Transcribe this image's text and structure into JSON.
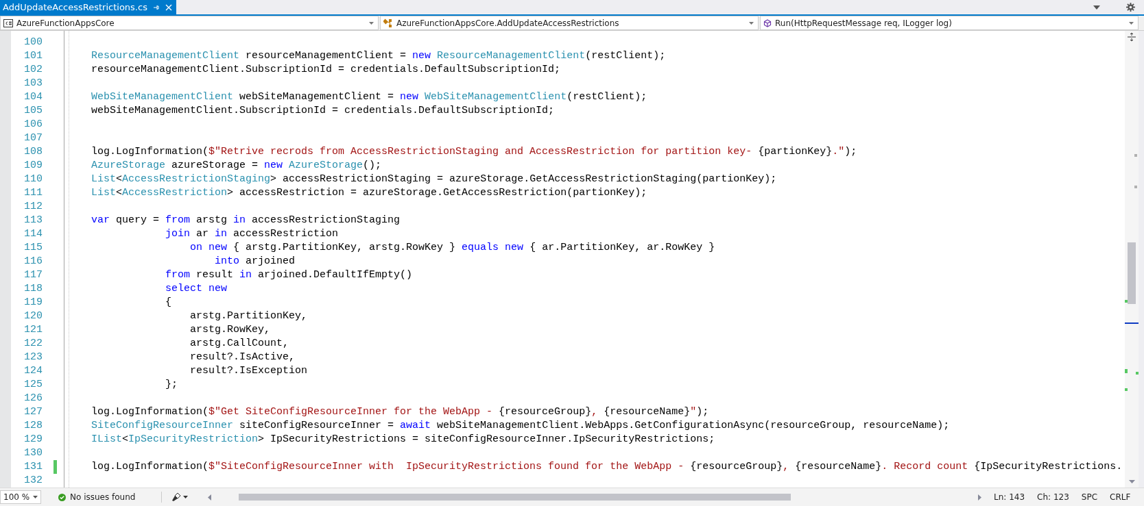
{
  "tab": {
    "title": "AddUpdateAccessRestrictions.cs",
    "selected": true
  },
  "nav": {
    "project": "AzureFunctionAppsCore",
    "type": "AzureFunctionAppsCore.AddUpdateAccessRestrictions",
    "member": "Run(HttpRequestMessage req, ILogger log)"
  },
  "editor": {
    "lines": [
      {
        "number": "100",
        "changed": false
      },
      {
        "number": "101",
        "changed": false,
        "tokens": [
          {
            "kind": "type",
            "text": "ResourceManagementClient"
          },
          {
            "kind": "plain",
            "text": " resourceManagementClient = "
          },
          {
            "kind": "keyword",
            "text": "new "
          },
          {
            "kind": "type",
            "text": "ResourceManagementClient"
          },
          {
            "kind": "plain",
            "text": "(restClient);"
          }
        ]
      },
      {
        "number": "102",
        "changed": false,
        "tokens": [
          {
            "kind": "plain",
            "text": "resourceManagementClient.SubscriptionId = credentials.DefaultSubscriptionId;"
          }
        ]
      },
      {
        "number": "103",
        "changed": false
      },
      {
        "number": "104",
        "changed": false,
        "tokens": [
          {
            "kind": "type",
            "text": "WebSiteManagementClient"
          },
          {
            "kind": "plain",
            "text": " webSiteManagementClient = "
          },
          {
            "kind": "keyword",
            "text": "new "
          },
          {
            "kind": "type",
            "text": "WebSiteManagementClient"
          },
          {
            "kind": "plain",
            "text": "(restClient);"
          }
        ]
      },
      {
        "number": "105",
        "changed": false,
        "tokens": [
          {
            "kind": "plain",
            "text": "webSiteManagementClient.SubscriptionId = credentials.DefaultSubscriptionId;"
          }
        ]
      },
      {
        "number": "106",
        "changed": false
      },
      {
        "number": "107",
        "changed": false
      },
      {
        "number": "108",
        "changed": false,
        "tokens": [
          {
            "kind": "plain",
            "text": "log.LogInformation("
          },
          {
            "kind": "string",
            "text": "$\"Retrive recrods from AccessRestrictionStaging and AccessRestriction for partition key- "
          },
          {
            "kind": "plain",
            "text": "{partionKey}"
          },
          {
            "kind": "string",
            "text": ".\""
          },
          {
            "kind": "plain",
            "text": ");"
          }
        ]
      },
      {
        "number": "109",
        "changed": false,
        "tokens": [
          {
            "kind": "type",
            "text": "AzureStorage"
          },
          {
            "kind": "plain",
            "text": " azureStorage = "
          },
          {
            "kind": "keyword",
            "text": "new "
          },
          {
            "kind": "type",
            "text": "AzureStorage"
          },
          {
            "kind": "plain",
            "text": "();"
          }
        ]
      },
      {
        "number": "110",
        "changed": false,
        "tokens": [
          {
            "kind": "type",
            "text": "List"
          },
          {
            "kind": "plain",
            "text": "<"
          },
          {
            "kind": "type",
            "text": "AccessRestrictionStaging"
          },
          {
            "kind": "plain",
            "text": "> accessRestrictionStaging = azureStorage.GetAccessRestrictionStaging(partionKey);"
          }
        ]
      },
      {
        "number": "111",
        "changed": false,
        "tokens": [
          {
            "kind": "type",
            "text": "List"
          },
          {
            "kind": "plain",
            "text": "<"
          },
          {
            "kind": "type",
            "text": "AccessRestriction"
          },
          {
            "kind": "plain",
            "text": "> accessRestriction = azureStorage.GetAccessRestriction(partionKey);"
          }
        ]
      },
      {
        "number": "112",
        "changed": false
      },
      {
        "number": "113",
        "changed": false,
        "tokens": [
          {
            "kind": "keyword",
            "text": "var"
          },
          {
            "kind": "plain",
            "text": " query = "
          },
          {
            "kind": "keyword",
            "text": "from"
          },
          {
            "kind": "plain",
            "text": " arstg "
          },
          {
            "kind": "keyword",
            "text": "in"
          },
          {
            "kind": "plain",
            "text": " accessRestrictionStaging"
          }
        ]
      },
      {
        "number": "114",
        "changed": false,
        "tokens": [
          {
            "kind": "keyword",
            "text": "            join"
          },
          {
            "kind": "plain",
            "text": " ar "
          },
          {
            "kind": "keyword",
            "text": "in"
          },
          {
            "kind": "plain",
            "text": " accessRestriction"
          }
        ]
      },
      {
        "number": "115",
        "changed": false,
        "tokens": [
          {
            "kind": "keyword",
            "text": "                on new"
          },
          {
            "kind": "plain",
            "text": " { arstg.PartitionKey, arstg.RowKey } "
          },
          {
            "kind": "keyword",
            "text": "equals new"
          },
          {
            "kind": "plain",
            "text": " { ar.PartitionKey, ar.RowKey }"
          }
        ]
      },
      {
        "number": "116",
        "changed": false,
        "tokens": [
          {
            "kind": "keyword",
            "text": "                    into"
          },
          {
            "kind": "plain",
            "text": " arjoined"
          }
        ]
      },
      {
        "number": "117",
        "changed": false,
        "tokens": [
          {
            "kind": "keyword",
            "text": "            from"
          },
          {
            "kind": "plain",
            "text": " result "
          },
          {
            "kind": "keyword",
            "text": "in"
          },
          {
            "kind": "plain",
            "text": " arjoined.DefaultIfEmpty()"
          }
        ]
      },
      {
        "number": "118",
        "changed": false,
        "tokens": [
          {
            "kind": "keyword",
            "text": "            select new"
          }
        ]
      },
      {
        "number": "119",
        "changed": false,
        "tokens": [
          {
            "kind": "plain",
            "text": "            {"
          }
        ]
      },
      {
        "number": "120",
        "changed": false,
        "tokens": [
          {
            "kind": "plain",
            "text": "                arstg.PartitionKey,"
          }
        ]
      },
      {
        "number": "121",
        "changed": false,
        "tokens": [
          {
            "kind": "plain",
            "text": "                arstg.RowKey,"
          }
        ]
      },
      {
        "number": "122",
        "changed": false,
        "tokens": [
          {
            "kind": "plain",
            "text": "                arstg.CallCount,"
          }
        ]
      },
      {
        "number": "123",
        "changed": false,
        "tokens": [
          {
            "kind": "plain",
            "text": "                result?.IsActive,"
          }
        ]
      },
      {
        "number": "124",
        "changed": false,
        "tokens": [
          {
            "kind": "plain",
            "text": "                result?.IsException"
          }
        ]
      },
      {
        "number": "125",
        "changed": false,
        "tokens": [
          {
            "kind": "plain",
            "text": "            };"
          }
        ]
      },
      {
        "number": "126",
        "changed": false
      },
      {
        "number": "127",
        "changed": false,
        "tokens": [
          {
            "kind": "plain",
            "text": "log.LogInformation("
          },
          {
            "kind": "string",
            "text": "$\"Get SiteConfigResourceInner for the WebApp - "
          },
          {
            "kind": "plain",
            "text": "{resourceGroup}"
          },
          {
            "kind": "string",
            "text": ", "
          },
          {
            "kind": "plain",
            "text": "{resourceName}"
          },
          {
            "kind": "string",
            "text": "\""
          },
          {
            "kind": "plain",
            "text": ");"
          }
        ]
      },
      {
        "number": "128",
        "changed": false,
        "tokens": [
          {
            "kind": "type",
            "text": "SiteConfigResourceInner"
          },
          {
            "kind": "plain",
            "text": " siteConfigResourceInner = "
          },
          {
            "kind": "keyword",
            "text": "await"
          },
          {
            "kind": "plain",
            "text": " webSiteManagementClient.WebApps.GetConfigurationAsync(resourceGroup, resourceName);"
          }
        ]
      },
      {
        "number": "129",
        "changed": false,
        "tokens": [
          {
            "kind": "type",
            "text": "IList"
          },
          {
            "kind": "plain",
            "text": "<"
          },
          {
            "kind": "type",
            "text": "IpSecurityRestriction"
          },
          {
            "kind": "plain",
            "text": "> IpSecurityRestrictions = siteConfigResourceInner.IpSecurityRestrictions;"
          }
        ]
      },
      {
        "number": "130",
        "changed": false
      },
      {
        "number": "131",
        "changed": true,
        "tokens": [
          {
            "kind": "plain",
            "text": "log.LogInformation("
          },
          {
            "kind": "string",
            "text": "$\"SiteConfigResourceInner with  IpSecurityRestrictions found for the WebApp - "
          },
          {
            "kind": "plain",
            "text": "{resourceGroup}"
          },
          {
            "kind": "string",
            "text": ", "
          },
          {
            "kind": "plain",
            "text": "{resourceName}"
          },
          {
            "kind": "string",
            "text": ". Record count "
          },
          {
            "kind": "plain",
            "text": "{IpSecurityRestrictions."
          }
        ]
      },
      {
        "number": "132",
        "changed": false
      }
    ]
  },
  "status_bar": {
    "zoom": "100 %",
    "issues": "No issues found",
    "line": "Ln: 143",
    "column": "Ch: 123",
    "indent": "SPC",
    "line_ending": "CRLF"
  }
}
